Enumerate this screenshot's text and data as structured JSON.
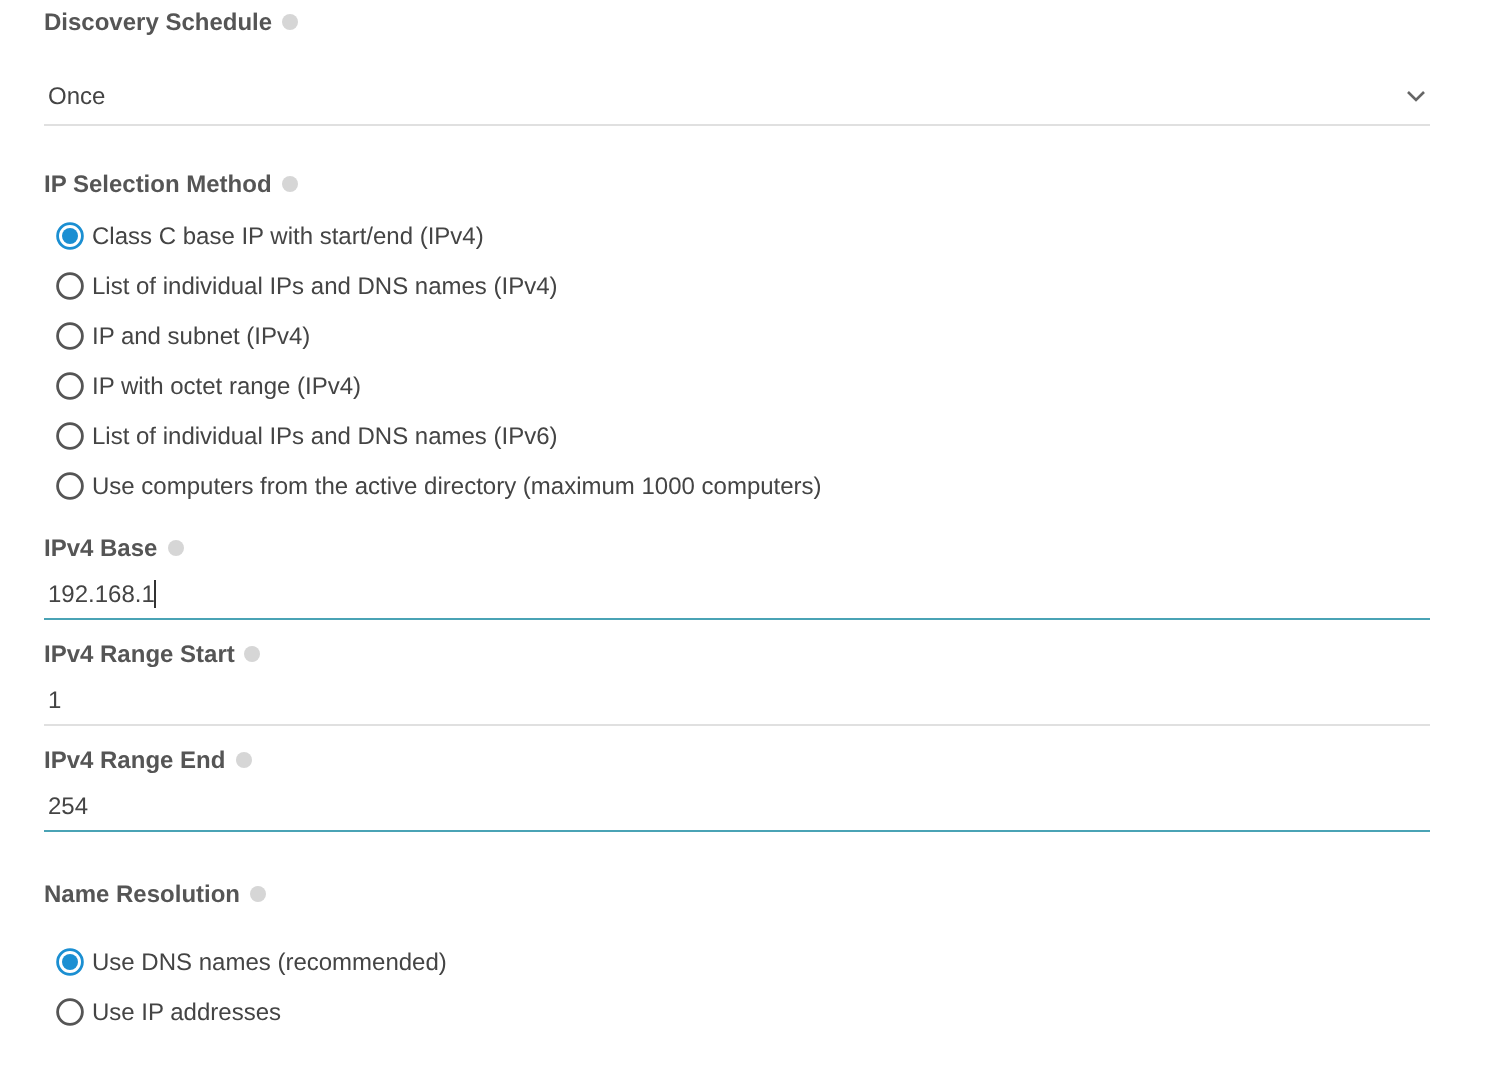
{
  "discovery_schedule": {
    "label": "Discovery Schedule",
    "value": "Once"
  },
  "ip_selection_method": {
    "label": "IP Selection Method",
    "options": [
      {
        "label": "Class C base IP with start/end (IPv4)",
        "selected": true
      },
      {
        "label": "List of individual IPs and DNS names (IPv4)",
        "selected": false
      },
      {
        "label": "IP and subnet (IPv4)",
        "selected": false
      },
      {
        "label": "IP with octet range (IPv4)",
        "selected": false
      },
      {
        "label": "List of individual IPs and DNS names (IPv6)",
        "selected": false
      },
      {
        "label": "Use computers from the active directory (maximum 1000 computers)",
        "selected": false
      }
    ]
  },
  "fields": [
    {
      "label": "IPv4 Base",
      "value": "192.168.1",
      "active": true,
      "caret": true
    },
    {
      "label": "IPv4 Range Start",
      "value": "1",
      "active": false,
      "caret": false
    },
    {
      "label": "IPv4 Range End",
      "value": "254",
      "active": true,
      "caret": false
    }
  ],
  "name_resolution": {
    "label": "Name Resolution",
    "options": [
      {
        "label": "Use DNS names (recommended)",
        "selected": true
      },
      {
        "label": "Use IP addresses",
        "selected": false
      }
    ]
  }
}
